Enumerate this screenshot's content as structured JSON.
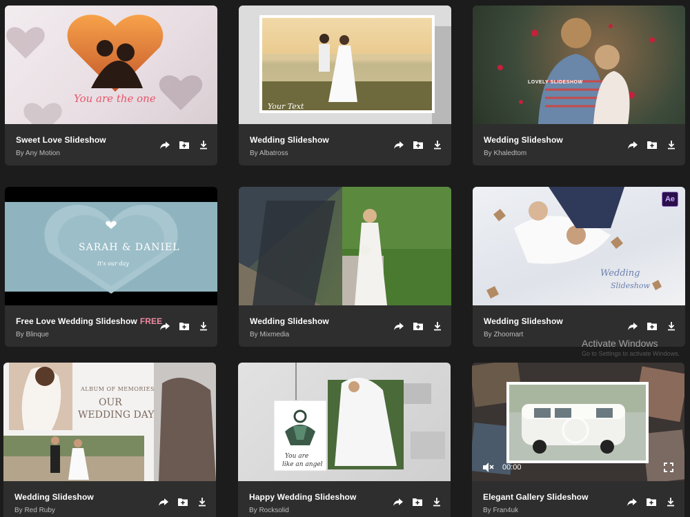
{
  "cards": [
    {
      "title": "Sweet Love Slideshow",
      "author": "By Any Motion",
      "overlay": "You are the one"
    },
    {
      "title": "Wedding Slideshow",
      "author": "By Albatross",
      "overlay": "Your Text"
    },
    {
      "title": "Wedding Slideshow",
      "author": "By Khaledtom",
      "overlay": "LOVELY SLIDESHOW"
    },
    {
      "title": "Free Love Wedding Slideshow",
      "badge": "FREE",
      "author": "By Blinque",
      "overlay": "SARAH & DANIEL",
      "overlay2": "It's our day"
    },
    {
      "title": "Wedding Slideshow",
      "author": "By Mixmedia"
    },
    {
      "title": "Wedding Slideshow",
      "author": "By Zhoomart",
      "overlay": "Wedding",
      "overlay2": "Slideshow",
      "app_badge": "Ae"
    },
    {
      "title": "Wedding Slideshow",
      "author": "By Red Ruby",
      "overlay": "ALBUM OF MEMORIES",
      "overlay2": "OUR",
      "overlay3": "WEDDING DAY"
    },
    {
      "title": "Happy Wedding Slideshow",
      "author": "By Rocksolid",
      "overlay": "You are",
      "overlay2": "like an angel"
    },
    {
      "title": "Elegant Gallery Slideshow",
      "author": "By Fran4uk",
      "video_time": "00:00"
    }
  ],
  "icons": {
    "share": "share-icon",
    "collect": "add-to-collection-icon",
    "download": "download-icon"
  },
  "watermark": {
    "line1": "Activate Windows",
    "line2": "Go to Settings to activate Windows."
  },
  "colors": {
    "background": "#1c1c1c",
    "card": "#2e2e2e",
    "free_badge": "#ee8aa0"
  }
}
